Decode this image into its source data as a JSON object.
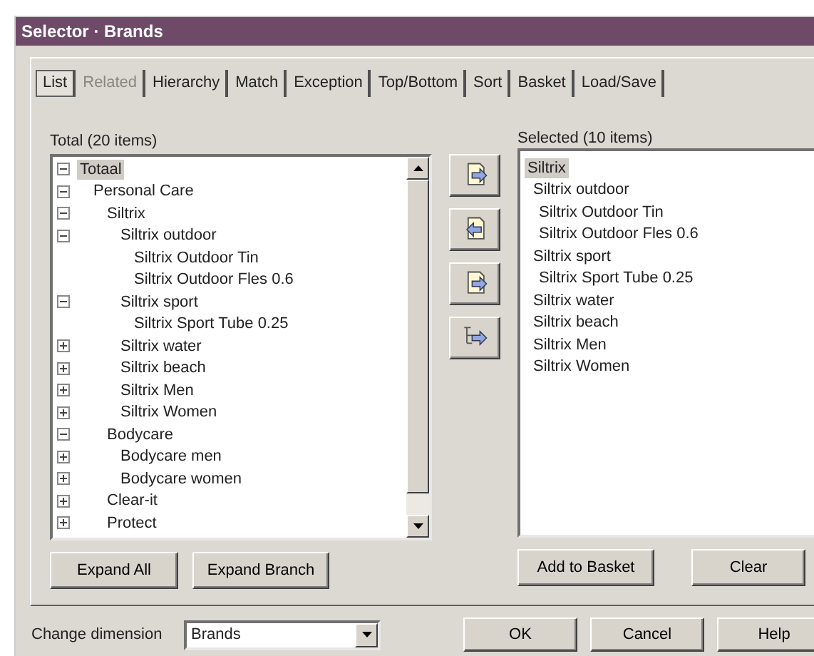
{
  "window": {
    "title": "Selector · Brands"
  },
  "tabs": [
    {
      "label": "List",
      "selected": true,
      "disabled": false
    },
    {
      "label": "Related",
      "selected": false,
      "disabled": true
    },
    {
      "label": "Hierarchy",
      "selected": false,
      "disabled": false
    },
    {
      "label": "Match",
      "selected": false,
      "disabled": false
    },
    {
      "label": "Exception",
      "selected": false,
      "disabled": false
    },
    {
      "label": "Top/Bottom",
      "selected": false,
      "disabled": false
    },
    {
      "label": "Sort",
      "selected": false,
      "disabled": false
    },
    {
      "label": "Basket",
      "selected": false,
      "disabled": false
    },
    {
      "label": "Load/Save",
      "selected": false,
      "disabled": false
    }
  ],
  "total": {
    "label": "Total (20 items)",
    "tree": [
      {
        "label": "Totaal",
        "selected": true,
        "expanded": true,
        "children": [
          {
            "label": "Personal Care",
            "selected": false,
            "expanded": true,
            "children": [
              {
                "label": "Siltrix",
                "selected": false,
                "expanded": true,
                "children": [
                  {
                    "label": "Siltrix outdoor",
                    "selected": false,
                    "expanded": true,
                    "children": [
                      {
                        "label": "Siltrix Outdoor Tin",
                        "selected": false
                      },
                      {
                        "label": "Siltrix Outdoor Fles 0.6",
                        "selected": false
                      }
                    ]
                  },
                  {
                    "label": "Siltrix sport",
                    "selected": false,
                    "expanded": true,
                    "children": [
                      {
                        "label": "Siltrix Sport Tube 0.25",
                        "selected": false
                      }
                    ]
                  },
                  {
                    "label": "Siltrix water",
                    "selected": false,
                    "expanded": false
                  },
                  {
                    "label": "Siltrix beach",
                    "selected": false,
                    "expanded": false
                  },
                  {
                    "label": "Siltrix Men",
                    "selected": false,
                    "expanded": false
                  },
                  {
                    "label": "Siltrix Women",
                    "selected": false,
                    "expanded": false
                  }
                ]
              },
              {
                "label": "Bodycare",
                "selected": false,
                "expanded": true,
                "children": [
                  {
                    "label": "Bodycare men",
                    "selected": false,
                    "expanded": false
                  },
                  {
                    "label": "Bodycare women",
                    "selected": false,
                    "expanded": false
                  }
                ]
              },
              {
                "label": "Clear-it",
                "selected": false,
                "expanded": false
              },
              {
                "label": "Protect",
                "selected": false,
                "expanded": false
              }
            ]
          }
        ]
      }
    ]
  },
  "selected": {
    "label": "Selected (10 items)",
    "tree": [
      {
        "label": "Siltrix",
        "selected": true,
        "children": [
          {
            "label": "Siltrix outdoor",
            "selected": false,
            "children": [
              {
                "label": "Siltrix Outdoor Tin",
                "selected": false
              },
              {
                "label": "Siltrix Outdoor Fles 0.6",
                "selected": false
              }
            ]
          },
          {
            "label": "Siltrix sport",
            "selected": false,
            "children": [
              {
                "label": "Siltrix Sport Tube 0.25",
                "selected": false
              }
            ]
          },
          {
            "label": "Siltrix water",
            "selected": false
          },
          {
            "label": "Siltrix beach",
            "selected": false
          },
          {
            "label": "Siltrix Men",
            "selected": false
          },
          {
            "label": "Siltrix Women",
            "selected": false
          }
        ]
      }
    ]
  },
  "left_buttons": [
    "Expand All",
    "Expand Branch"
  ],
  "right_buttons": [
    "Add to Basket",
    "Clear"
  ],
  "change_dimension": {
    "label": "Change dimension",
    "value": "Brands"
  },
  "dialog_buttons": [
    "OK",
    "Cancel",
    "Help"
  ]
}
